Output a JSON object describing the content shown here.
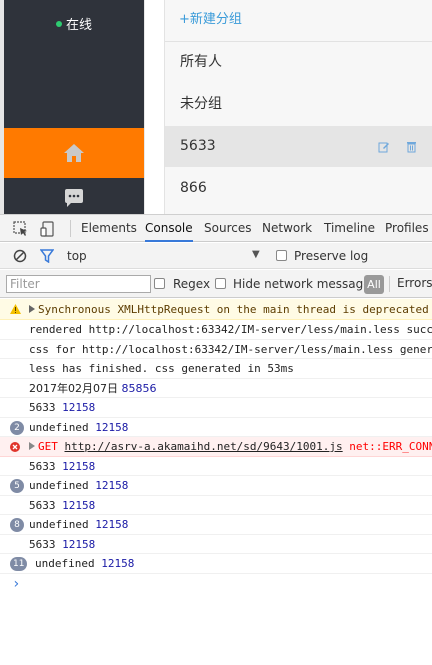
{
  "app": {
    "status_label": "在线",
    "accent_color": "#ff7a00",
    "sidebar_bg": "#2f333b",
    "nav": {
      "home_icon": "home-icon",
      "chat_icon": "chat-icon"
    },
    "new_group_label": "+新建分组",
    "groups": [
      {
        "name": "所有人"
      },
      {
        "name": "未分组"
      },
      {
        "name": "5633",
        "selected": true
      },
      {
        "name": "866"
      }
    ]
  },
  "devtools": {
    "tabs": [
      "Elements",
      "Console",
      "Sources",
      "Network",
      "Timeline",
      "Profiles"
    ],
    "active_tab": "Console",
    "context": "top",
    "preserve_log_label": "Preserve log",
    "filter_placeholder": "Filter",
    "regex_label": "Regex",
    "hide_network_label": "Hide network messages",
    "level_all_label": "All",
    "level_errors_label": "Errors",
    "messages": {
      "warn": "Synchronous XMLHttpRequest on the main thread is deprecated",
      "less1_prefix": "rendered ",
      "less1_url": "http://localhost:63342/IM-server/less/main.less",
      "less1_suffix": " succe",
      "less2_prefix": "css for ",
      "less2_url": "http://localhost:63342/IM-server/less/main.less",
      "less2_suffix": " genera",
      "less3": "less has finished. css generated in 53ms",
      "date_text": "2017年02月07日",
      "date_num": "85856",
      "row_a_text": "5633",
      "row_a_num": "12158",
      "row_b_count": "2",
      "row_b_text": "undefined",
      "row_b_num": "12158",
      "err_method": "GET",
      "err_url": "http://asrv-a.akamaihd.net/sd/9643/1001.js",
      "err_code": "net::ERR_CONN",
      "row_c_text": "5633",
      "row_c_num": "12158",
      "row_d_count": "5",
      "row_d_text": "undefined",
      "row_d_num": "12158",
      "row_e_text": "5633",
      "row_e_num": "12158",
      "row_f_count": "8",
      "row_f_text": "undefined",
      "row_f_num": "12158",
      "row_g_text": "5633",
      "row_g_num": "12158",
      "row_h_count": "11",
      "row_h_text": "undefined",
      "row_h_num": "12158",
      "prompt_symbol": "›"
    }
  }
}
